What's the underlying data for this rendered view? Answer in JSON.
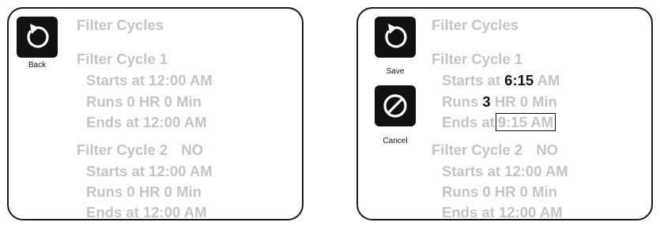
{
  "left": {
    "back_label": "Back",
    "title": "Filter Cycles",
    "cycle1": {
      "title": "Filter Cycle 1",
      "starts_prefix": "Starts at",
      "starts_value": "12:00 AM",
      "runs": "Runs 0 HR 0 Min",
      "ends_prefix": "Ends at",
      "ends_value": "12:00 AM"
    },
    "cycle2": {
      "title": "Filter Cycle 2",
      "state": "NO",
      "starts": "Starts at 12:00 AM",
      "runs": "Runs 0 HR 0 Min",
      "ends": "Ends at 12:00 AM"
    }
  },
  "right": {
    "save_label": "Save",
    "cancel_label": "Cancel",
    "title": "Filter Cycles",
    "cycle1": {
      "title": "Filter Cycle 1",
      "starts_prefix": "Starts at",
      "starts_time": "6:15",
      "starts_ampm": "AM",
      "runs_prefix": "Runs",
      "runs_hours": "3",
      "runs_suffix": "HR 0 Min",
      "ends_prefix": "Ends at",
      "ends_value": "9:15 AM"
    },
    "cycle2": {
      "title": "Filter Cycle 2",
      "state": "NO",
      "starts": "Starts at 12:00 AM",
      "runs": "Runs 0 HR 0 Min",
      "ends": "Ends at 12:00 AM"
    }
  },
  "colors": {
    "dim_text": "#c4c4c4",
    "highlight_text": "#111111",
    "button_bg": "#111111"
  },
  "icons": {
    "back": "back-arrow-icon",
    "save": "save-arrow-icon",
    "cancel": "cancel-icon"
  }
}
